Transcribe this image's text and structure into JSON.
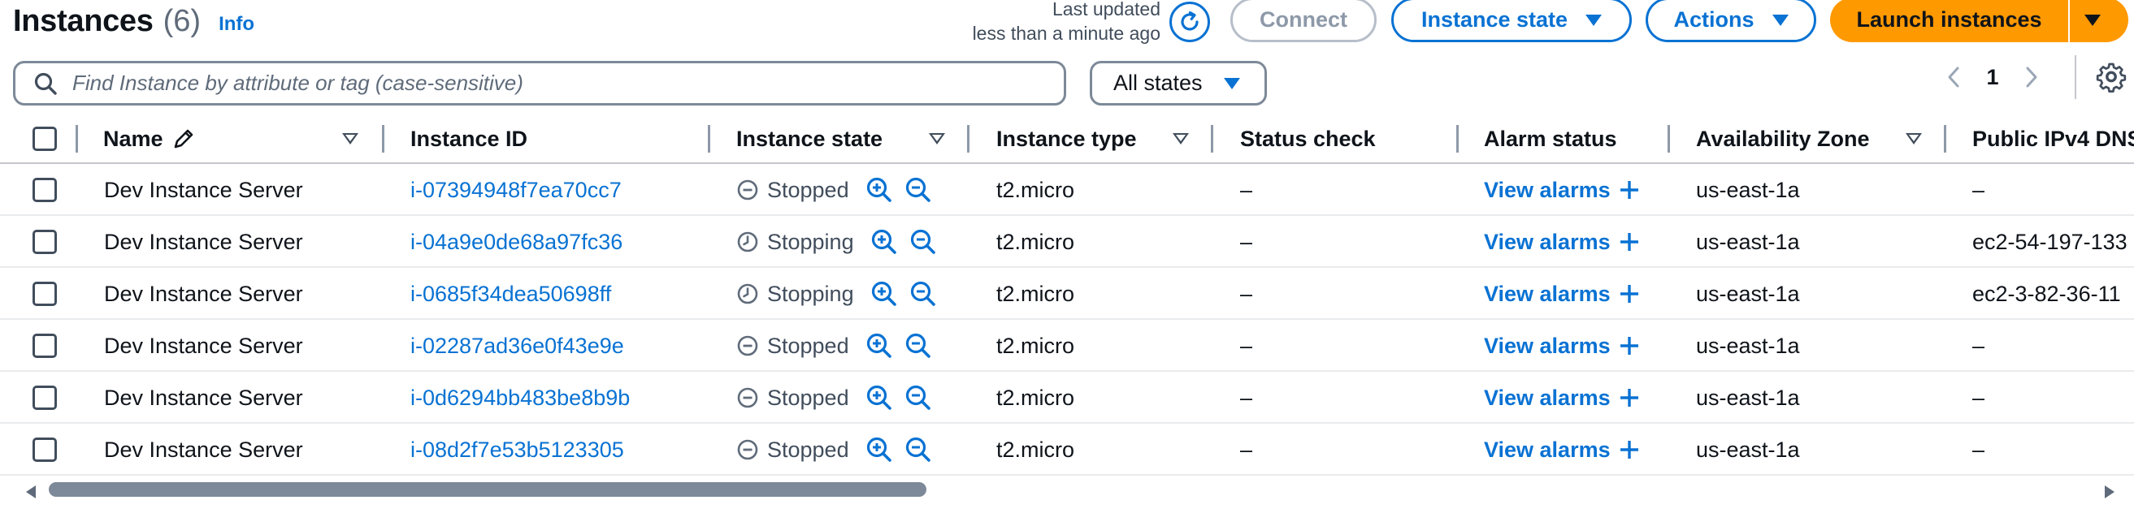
{
  "header": {
    "title": "Instances",
    "count": "(6)",
    "info": "Info",
    "last_updated_line1": "Last updated",
    "last_updated_line2": "less than a minute ago",
    "connect": "Connect",
    "instance_state": "Instance state",
    "actions": "Actions",
    "launch": "Launch instances"
  },
  "filter": {
    "search_placeholder": "Find Instance by attribute or tag (case-sensitive)",
    "states_select": "All states"
  },
  "pagination": {
    "current_page": "1"
  },
  "columns": {
    "name": "Name",
    "instance_id": "Instance ID",
    "instance_state": "Instance state",
    "instance_type": "Instance type",
    "status_check": "Status check",
    "alarm_status": "Alarm status",
    "availability_zone": "Availability Zone",
    "public_dns": "Public IPv4 DNS"
  },
  "rows": [
    {
      "name": "Dev Instance Server",
      "id": "i-07394948f7ea70cc7",
      "state": "Stopped",
      "type": "t2.micro",
      "status": "–",
      "alarm": "View alarms",
      "az": "us-east-1a",
      "dns": "–"
    },
    {
      "name": "Dev Instance Server",
      "id": "i-04a9e0de68a97fc36",
      "state": "Stopping",
      "type": "t2.micro",
      "status": "–",
      "alarm": "View alarms",
      "az": "us-east-1a",
      "dns": "ec2-54-197-133"
    },
    {
      "name": "Dev Instance Server",
      "id": "i-0685f34dea50698ff",
      "state": "Stopping",
      "type": "t2.micro",
      "status": "–",
      "alarm": "View alarms",
      "az": "us-east-1a",
      "dns": "ec2-3-82-36-11"
    },
    {
      "name": "Dev Instance Server",
      "id": "i-02287ad36e0f43e9e",
      "state": "Stopped",
      "type": "t2.micro",
      "status": "–",
      "alarm": "View alarms",
      "az": "us-east-1a",
      "dns": "–"
    },
    {
      "name": "Dev Instance Server",
      "id": "i-0d6294bb483be8b9b",
      "state": "Stopped",
      "type": "t2.micro",
      "status": "–",
      "alarm": "View alarms",
      "az": "us-east-1a",
      "dns": "–"
    },
    {
      "name": "Dev Instance Server",
      "id": "i-08d2f7e53b5123305",
      "state": "Stopped",
      "type": "t2.micro",
      "status": "–",
      "alarm": "View alarms",
      "az": "us-east-1a",
      "dns": "–"
    }
  ],
  "colors": {
    "link": "#0972d3",
    "primary_button": "#ff9900",
    "text": "#0f141a",
    "muted": "#414d5c"
  }
}
